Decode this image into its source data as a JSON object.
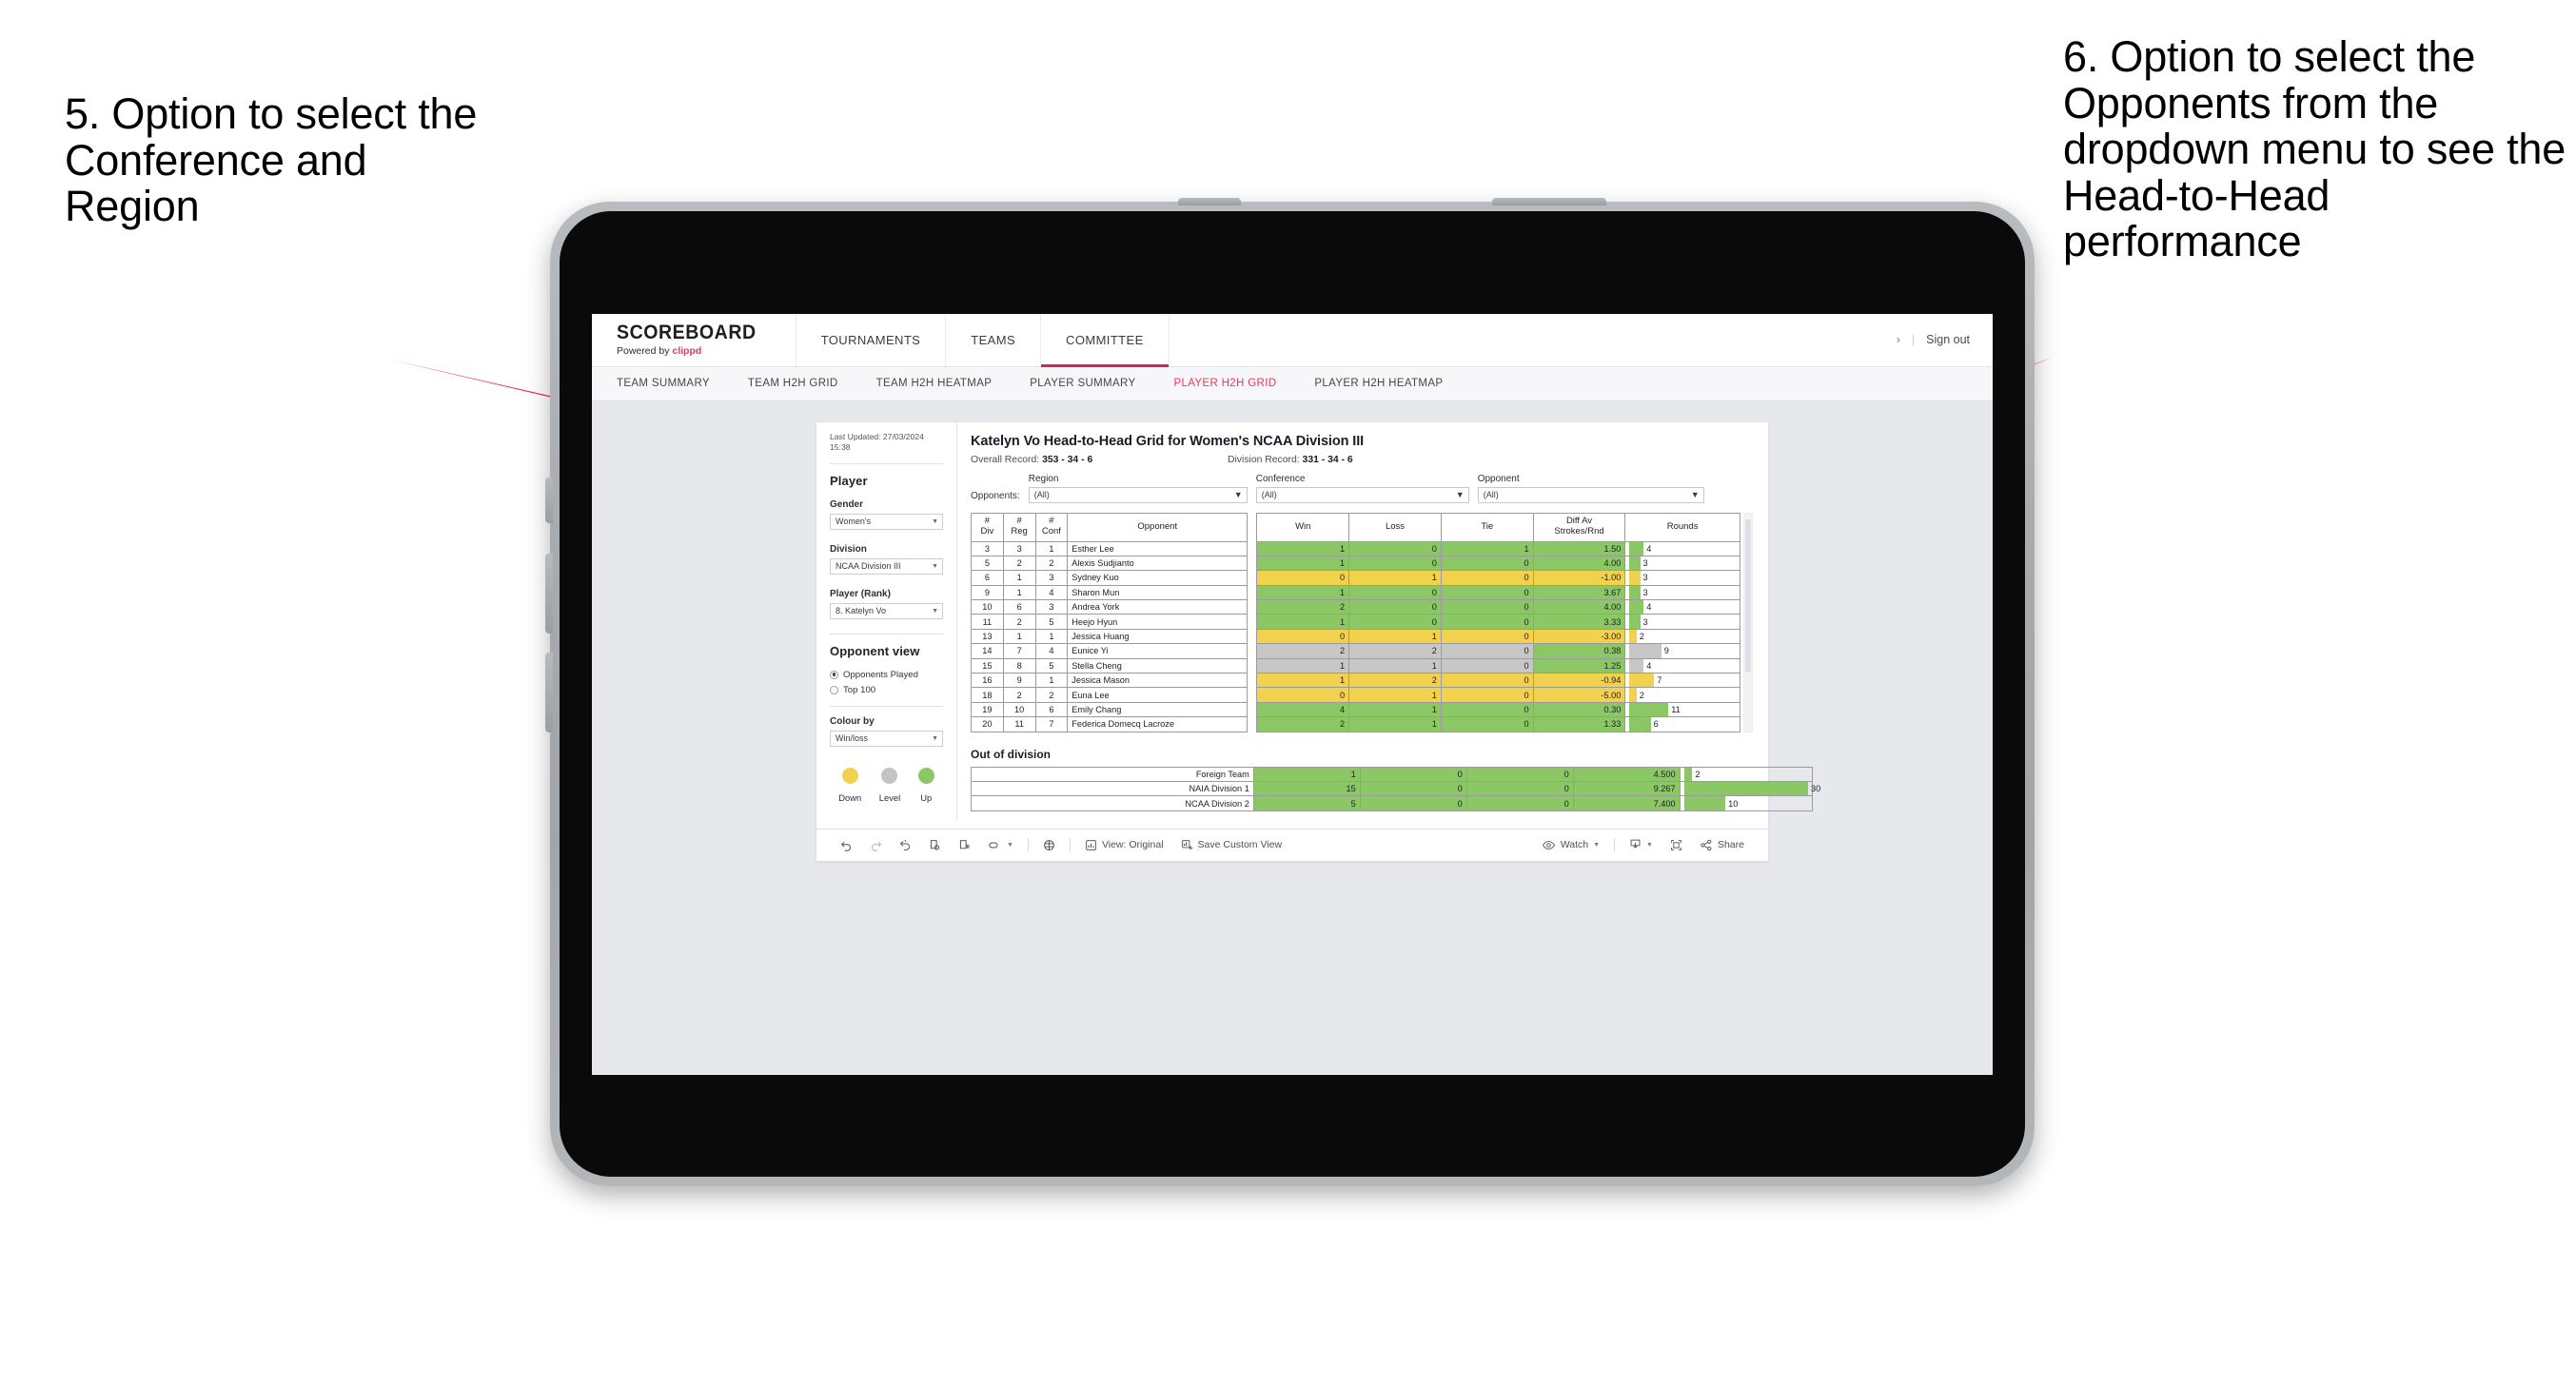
{
  "annotations": {
    "left": "5. Option to select the Conference and Region",
    "right": "6. Option to select the Opponents from the dropdown menu to see the Head-to-Head performance",
    "arrow_color": "#e8295c"
  },
  "topnav": {
    "brand": "SCOREBOARD",
    "brand_sub_prefix": "Powered by",
    "brand_sub_name": "clippd",
    "items": [
      {
        "label": "TOURNAMENTS",
        "active": false
      },
      {
        "label": "TEAMS",
        "active": false
      },
      {
        "label": "COMMITTEE",
        "active": true
      }
    ],
    "sign_out": "Sign out",
    "accent": "#d9254e"
  },
  "subnav": {
    "items": [
      {
        "label": "TEAM SUMMARY",
        "active": false
      },
      {
        "label": "TEAM H2H GRID",
        "active": false
      },
      {
        "label": "TEAM H2H HEATMAP",
        "active": false
      },
      {
        "label": "PLAYER SUMMARY",
        "active": false
      },
      {
        "label": "PLAYER H2H GRID",
        "active": true
      },
      {
        "label": "PLAYER H2H HEATMAP",
        "active": false
      }
    ],
    "active_color": "#e8385e"
  },
  "sidebar": {
    "last_updated": "Last Updated: 27/03/2024 15:38",
    "player_heading": "Player",
    "gender_label": "Gender",
    "gender_value": "Women's",
    "division_label": "Division",
    "division_value": "NCAA Division III",
    "player_rank_label": "Player (Rank)",
    "player_rank_value": "8. Katelyn Vo",
    "opponent_view_heading": "Opponent view",
    "opponent_view_options": [
      {
        "label": "Opponents Played",
        "selected": true
      },
      {
        "label": "Top 100",
        "selected": false
      }
    ],
    "colour_by_label": "Colour by",
    "colour_by_value": "Win/loss",
    "legend": [
      {
        "label": "Down",
        "color": "#f2d14e"
      },
      {
        "label": "Level",
        "color": "#c4c4c4"
      },
      {
        "label": "Up",
        "color": "#8cc765"
      }
    ]
  },
  "main": {
    "title": "Katelyn Vo Head-to-Head Grid for Women's NCAA Division III",
    "overall_record_label": "Overall Record:",
    "overall_record_value": "353 -  34 - 6",
    "division_record_label": "Division Record:",
    "division_record_value": "331 -  34 - 6",
    "opponents_prefix": "Opponents:",
    "filters": [
      {
        "label": "Region",
        "value": "(All)"
      },
      {
        "label": "Conference",
        "value": "(All)"
      },
      {
        "label": "Opponent",
        "value": "(All)"
      }
    ]
  },
  "chart_data": {
    "type": "table",
    "title": "Katelyn Vo Head-to-Head Grid for Women's NCAA Division III",
    "columns": [
      "# Div",
      "# Reg",
      "# Conf",
      "Opponent",
      "Win",
      "Loss",
      "Tie",
      "Diff Av Strokes/Rnd",
      "Rounds"
    ],
    "column_headers_multiline": [
      [
        "#",
        "Div"
      ],
      [
        "#",
        "Reg"
      ],
      [
        "#",
        "Conf"
      ],
      [
        "Opponent"
      ],
      [
        "Win"
      ],
      [
        "Loss"
      ],
      [
        "Tie"
      ],
      [
        "Diff Av",
        "Strokes/Rnd"
      ],
      [
        "Rounds"
      ]
    ],
    "rounds_max": 30,
    "rows": [
      {
        "div": "3",
        "reg": "3",
        "conf": "1",
        "opponent": "Esther Lee",
        "win": "1",
        "loss": "0",
        "tie": "1",
        "diff": "1.50",
        "rounds": "4",
        "color": "up"
      },
      {
        "div": "5",
        "reg": "2",
        "conf": "2",
        "opponent": "Alexis Sudjianto",
        "win": "1",
        "loss": "0",
        "tie": "0",
        "diff": "4.00",
        "rounds": "3",
        "color": "up"
      },
      {
        "div": "6",
        "reg": "1",
        "conf": "3",
        "opponent": "Sydney Kuo",
        "win": "0",
        "loss": "1",
        "tie": "0",
        "diff": "-1.00",
        "rounds": "3",
        "color": "down"
      },
      {
        "div": "9",
        "reg": "1",
        "conf": "4",
        "opponent": "Sharon Mun",
        "win": "1",
        "loss": "0",
        "tie": "0",
        "diff": "3.67",
        "rounds": "3",
        "color": "up"
      },
      {
        "div": "10",
        "reg": "6",
        "conf": "3",
        "opponent": "Andrea York",
        "win": "2",
        "loss": "0",
        "tie": "0",
        "diff": "4.00",
        "rounds": "4",
        "color": "up"
      },
      {
        "div": "11",
        "reg": "2",
        "conf": "5",
        "opponent": "Heejo Hyun",
        "win": "1",
        "loss": "0",
        "tie": "0",
        "diff": "3.33",
        "rounds": "3",
        "color": "up"
      },
      {
        "div": "13",
        "reg": "1",
        "conf": "1",
        "opponent": "Jessica Huang",
        "win": "0",
        "loss": "1",
        "tie": "0",
        "diff": "-3.00",
        "rounds": "2",
        "color": "down"
      },
      {
        "div": "14",
        "reg": "7",
        "conf": "4",
        "opponent": "Eunice Yi",
        "win": "2",
        "loss": "2",
        "tie": "0",
        "diff": "0.38",
        "rounds": "9",
        "color": "level",
        "diff_color": "up"
      },
      {
        "div": "15",
        "reg": "8",
        "conf": "5",
        "opponent": "Stella Cheng",
        "win": "1",
        "loss": "1",
        "tie": "0",
        "diff": "1.25",
        "rounds": "4",
        "color": "level",
        "diff_color": "up"
      },
      {
        "div": "16",
        "reg": "9",
        "conf": "1",
        "opponent": "Jessica Mason",
        "win": "1",
        "loss": "2",
        "tie": "0",
        "diff": "-0.94",
        "rounds": "7",
        "color": "down"
      },
      {
        "div": "18",
        "reg": "2",
        "conf": "2",
        "opponent": "Euna Lee",
        "win": "0",
        "loss": "1",
        "tie": "0",
        "diff": "-5.00",
        "rounds": "2",
        "color": "down"
      },
      {
        "div": "19",
        "reg": "10",
        "conf": "6",
        "opponent": "Emily Chang",
        "win": "4",
        "loss": "1",
        "tie": "0",
        "diff": "0.30",
        "rounds": "11",
        "color": "up"
      },
      {
        "div": "20",
        "reg": "11",
        "conf": "7",
        "opponent": "Federica Domecq Lacroze",
        "win": "2",
        "loss": "1",
        "tie": "0",
        "diff": "1.33",
        "rounds": "6",
        "color": "up"
      }
    ],
    "out_of_division_title": "Out of division",
    "out_of_division_rows": [
      {
        "name": "Foreign Team",
        "win": "1",
        "loss": "0",
        "tie": "0",
        "diff": "4.500",
        "rounds": "2",
        "color": "up"
      },
      {
        "name": "NAIA Division 1",
        "win": "15",
        "loss": "0",
        "tie": "0",
        "diff": "9.267",
        "rounds": "30",
        "color": "up"
      },
      {
        "name": "NCAA Division 2",
        "win": "5",
        "loss": "0",
        "tie": "0",
        "diff": "7.400",
        "rounds": "10",
        "color": "up"
      }
    ],
    "colors": {
      "up": "#8cc765",
      "down": "#f2d14e",
      "level": "#c7c7c7"
    }
  },
  "toolbar": {
    "view_label": "View: Original",
    "save_label": "Save Custom View",
    "watch_label": "Watch",
    "share_label": "Share"
  }
}
